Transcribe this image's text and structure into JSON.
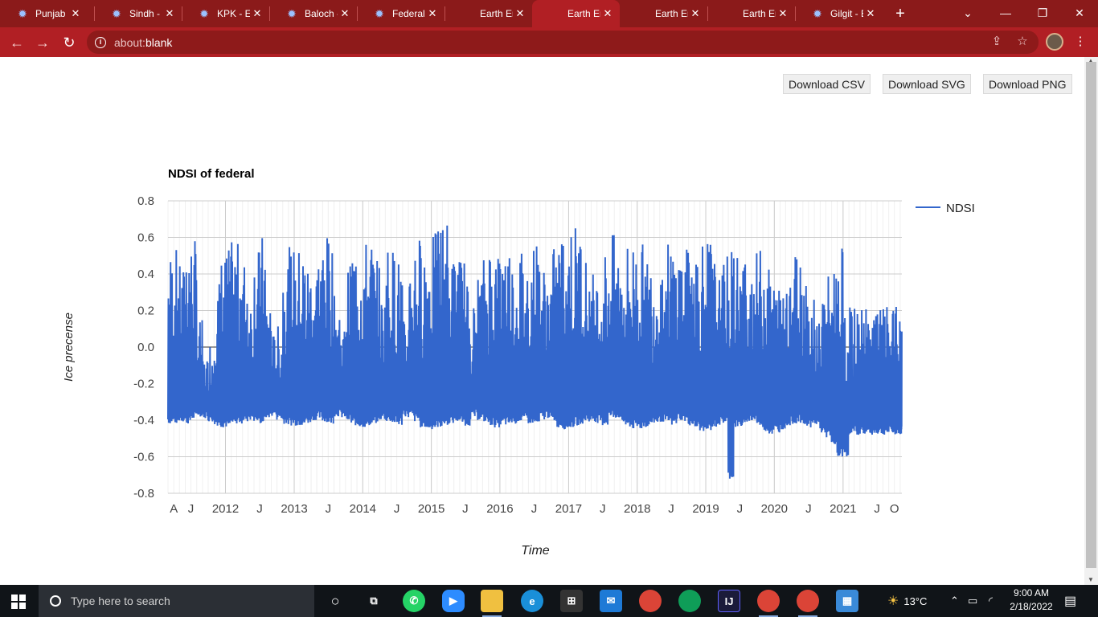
{
  "browser": {
    "tabs": [
      {
        "label": "Punjab - ",
        "icon": "gear-icon",
        "active": false
      },
      {
        "label": "Sindh - E",
        "icon": "gear-icon",
        "active": false
      },
      {
        "label": "KPK - Ea",
        "icon": "gear-icon",
        "active": false
      },
      {
        "label": "Baloch - ",
        "icon": "gear-icon",
        "active": false
      },
      {
        "label": "Federal - ",
        "icon": "gear-icon",
        "active": false
      },
      {
        "label": "Earth En",
        "icon": "",
        "active": false
      },
      {
        "label": "Earth En",
        "icon": "",
        "active": true
      },
      {
        "label": "Earth En",
        "icon": "",
        "active": false
      },
      {
        "label": "Earth En",
        "icon": "",
        "active": false
      },
      {
        "label": "Gilgit - E",
        "icon": "gear-icon",
        "active": false
      }
    ],
    "url_scheme": "about:",
    "url_path": "blank",
    "colors": {
      "frame": "#8b1a1a",
      "toolbar": "#b11f24"
    }
  },
  "page": {
    "buttons": {
      "csv": "Download CSV",
      "svg": "Download SVG",
      "png": "Download PNG"
    }
  },
  "chart_data": {
    "type": "line",
    "title": "NDSI of federal",
    "xlabel": "Time",
    "ylabel": "Ice precense",
    "ylim": [
      -0.8,
      0.8
    ],
    "yticks": [
      "0.8",
      "0.6",
      "0.4",
      "0.2",
      "0.0",
      "-0.2",
      "-0.4",
      "-0.6",
      "-0.8"
    ],
    "xticks": [
      "A",
      "J",
      "2012",
      "J",
      "2013",
      "J",
      "2014",
      "J",
      "2015",
      "J",
      "2016",
      "J",
      "2017",
      "J",
      "2018",
      "J",
      "2019",
      "J",
      "2020",
      "J",
      "2021",
      "J",
      "O"
    ],
    "xrange": [
      "2011-03-01",
      "2021-11-10"
    ],
    "legend": "right",
    "grid": true,
    "series": [
      {
        "name": "NDSI",
        "color": "#3366cc",
        "x": [
          "2011-03",
          "2011-04",
          "2011-05",
          "2011-06",
          "2011-07",
          "2011-08",
          "2011-09",
          "2011-10",
          "2011-11",
          "2011-12",
          "2012-01",
          "2012-02",
          "2012-03",
          "2012-04",
          "2012-05",
          "2012-06",
          "2012-07",
          "2012-08",
          "2012-09",
          "2012-10",
          "2012-11",
          "2012-12",
          "2013-01",
          "2013-02",
          "2013-03",
          "2013-04",
          "2013-05",
          "2013-06",
          "2013-07",
          "2013-08",
          "2013-09",
          "2013-10",
          "2013-11",
          "2013-12",
          "2014-01",
          "2014-02",
          "2014-03",
          "2014-04",
          "2014-05",
          "2014-06",
          "2014-07",
          "2014-08",
          "2014-09",
          "2014-10",
          "2014-11",
          "2014-12",
          "2015-01",
          "2015-02",
          "2015-03",
          "2015-04",
          "2015-05",
          "2015-06",
          "2015-07",
          "2015-08",
          "2015-09",
          "2015-10",
          "2015-11",
          "2015-12",
          "2016-01",
          "2016-02",
          "2016-03",
          "2016-04",
          "2016-05",
          "2016-06",
          "2016-07",
          "2016-08",
          "2016-09",
          "2016-10",
          "2016-11",
          "2016-12",
          "2017-01",
          "2017-02",
          "2017-03",
          "2017-04",
          "2017-05",
          "2017-06",
          "2017-07",
          "2017-08",
          "2017-09",
          "2017-10",
          "2017-11",
          "2017-12",
          "2018-01",
          "2018-02",
          "2018-03",
          "2018-04",
          "2018-05",
          "2018-06",
          "2018-07",
          "2018-08",
          "2018-09",
          "2018-10",
          "2018-11",
          "2018-12",
          "2019-01",
          "2019-02",
          "2019-03",
          "2019-04",
          "2019-05",
          "2019-06",
          "2019-07",
          "2019-08",
          "2019-09",
          "2019-10",
          "2019-11",
          "2019-12",
          "2020-01",
          "2020-02",
          "2020-03",
          "2020-04",
          "2020-05",
          "2020-06",
          "2020-07",
          "2020-08",
          "2020-09",
          "2020-10",
          "2020-11",
          "2020-12",
          "2021-01",
          "2021-02",
          "2021-03",
          "2021-04",
          "2021-05",
          "2021-06",
          "2021-07",
          "2021-08",
          "2021-09",
          "2021-10",
          "2021-11"
        ],
        "hi": [
          0.54,
          0.55,
          0.45,
          0.65,
          0.6,
          0.15,
          -0.05,
          0.05,
          0.38,
          0.52,
          0.55,
          0.58,
          0.57,
          0.49,
          0.3,
          0.55,
          0.62,
          0.3,
          0.08,
          0.12,
          0.5,
          0.55,
          0.55,
          0.56,
          0.48,
          0.45,
          0.55,
          0.61,
          0.6,
          0.28,
          0.12,
          0.45,
          0.58,
          0.6,
          0.59,
          0.62,
          0.48,
          0.3,
          0.58,
          0.55,
          0.5,
          0.15,
          0.5,
          0.62,
          0.6,
          0.62,
          0.63,
          0.72,
          0.71,
          0.5,
          0.55,
          0.5,
          0.35,
          0.25,
          0.4,
          0.5,
          0.6,
          0.55,
          0.59,
          0.6,
          0.5,
          0.55,
          0.5,
          0.57,
          0.6,
          0.45,
          0.42,
          0.55,
          0.62,
          0.65,
          0.69,
          0.68,
          0.65,
          0.5,
          0.42,
          0.4,
          0.55,
          0.62,
          0.55,
          0.5,
          0.58,
          0.6,
          0.57,
          0.5,
          0.5,
          0.45,
          0.5,
          0.58,
          0.55,
          0.55,
          0.55,
          0.6,
          0.6,
          0.64,
          0.6,
          0.5,
          0.4,
          0.5,
          0.57,
          0.55,
          0.5,
          0.45,
          0.52,
          0.55,
          0.5,
          0.45,
          0.35,
          0.4,
          0.52,
          0.55,
          0.53,
          0.45,
          0.3,
          0.2,
          0.3,
          0.4,
          0.52,
          0.55,
          0.22,
          0.22,
          0.22,
          0.22,
          0.22,
          0.22,
          0.22,
          0.22,
          0.22,
          0.22,
          0.22
        ],
        "lo": [
          -0.42,
          -0.42,
          -0.41,
          -0.42,
          -0.4,
          -0.38,
          -0.39,
          -0.41,
          -0.43,
          -0.44,
          -0.44,
          -0.43,
          -0.42,
          -0.41,
          -0.4,
          -0.41,
          -0.42,
          -0.39,
          -0.38,
          -0.4,
          -0.42,
          -0.43,
          -0.43,
          -0.43,
          -0.42,
          -0.4,
          -0.4,
          -0.41,
          -0.42,
          -0.38,
          -0.39,
          -0.41,
          -0.43,
          -0.44,
          -0.44,
          -0.43,
          -0.42,
          -0.4,
          -0.41,
          -0.42,
          -0.43,
          -0.38,
          -0.39,
          -0.41,
          -0.44,
          -0.45,
          -0.45,
          -0.44,
          -0.43,
          -0.42,
          -0.41,
          -0.42,
          -0.43,
          -0.39,
          -0.4,
          -0.41,
          -0.43,
          -0.44,
          -0.43,
          -0.43,
          -0.42,
          -0.41,
          -0.41,
          -0.42,
          -0.43,
          -0.4,
          -0.39,
          -0.41,
          -0.44,
          -0.45,
          -0.44,
          -0.43,
          -0.42,
          -0.41,
          -0.41,
          -0.42,
          -0.43,
          -0.39,
          -0.39,
          -0.42,
          -0.44,
          -0.45,
          -0.45,
          -0.44,
          -0.43,
          -0.42,
          -0.41,
          -0.42,
          -0.43,
          -0.4,
          -0.41,
          -0.43,
          -0.45,
          -0.46,
          -0.46,
          -0.44,
          -0.43,
          -0.42,
          -0.72,
          -0.44,
          -0.44,
          -0.41,
          -0.41,
          -0.43,
          -0.46,
          -0.48,
          -0.47,
          -0.45,
          -0.43,
          -0.42,
          -0.42,
          -0.43,
          -0.44,
          -0.43,
          -0.47,
          -0.5,
          -0.55,
          -0.6,
          -0.6,
          -0.48,
          -0.48,
          -0.48,
          -0.48,
          -0.48,
          -0.48,
          -0.48,
          -0.48,
          -0.48,
          -0.48,
          -0.48,
          -0.48
        ]
      }
    ]
  },
  "taskbar": {
    "search_placeholder": "Type here to search",
    "temperature": "13°C",
    "time": "9:00 AM",
    "date": "2/18/2022"
  }
}
